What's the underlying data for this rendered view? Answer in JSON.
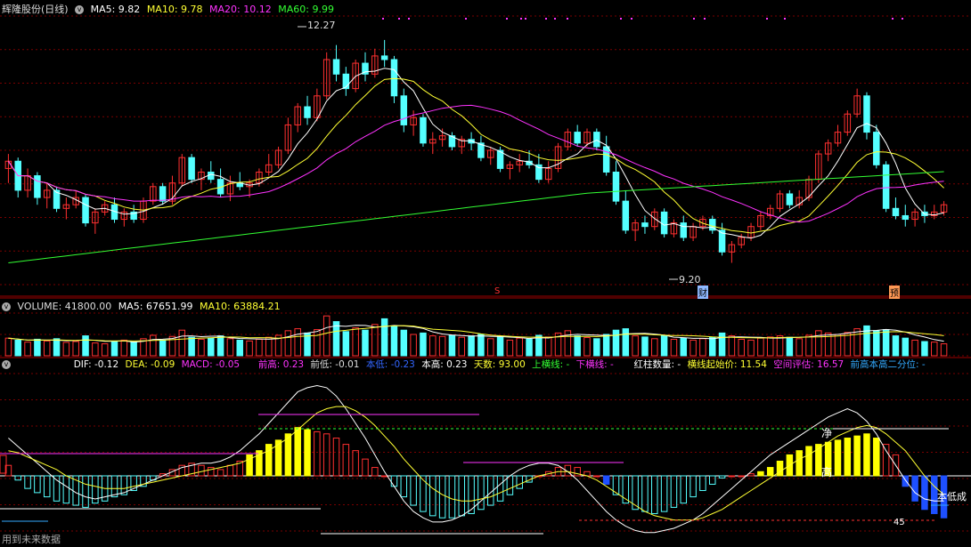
{
  "colors": {
    "up": "#ff3030",
    "down": "#54ffff",
    "ma5": "#ffffff",
    "ma10": "#ffff33",
    "ma20": "#ff33ff",
    "ma60": "#33ff33",
    "grid": "#7a0000",
    "yellow_bar": "#ffff00",
    "blue_bar": "#1e50ff"
  },
  "price_panel": {
    "title": "辉隆股份(日线)",
    "ma5_label": "MA5: 9.82",
    "ma10_label": "MA10: 9.78",
    "ma20_label": "MA20: 10.12",
    "ma60_label": "MA60: 9.99",
    "high_label": "12.27",
    "low_label": "9.20",
    "marker_s": "S",
    "marker_cai": "财",
    "marker_yu": "预"
  },
  "volume_panel": {
    "vol_label": "VOLUME: 41800.00",
    "ma5_label": "MA5: 67651.99",
    "ma10_label": "MA10: 63884.21"
  },
  "macd_panel": {
    "dif_label": "DIF: -0.12",
    "dea_label": "DEA: -0.09",
    "macd_label": "MACD: -0.05",
    "qiangao": "前高: 0.23",
    "qiandi": "前低: -0.01",
    "bendi": "本低: -0.23",
    "bengao": "本高: 0.23",
    "tianshu": "天数: 93.00",
    "shanghx": "上横线: -",
    "xiahx": "下横线: -",
    "hongzhu": "红柱数量: -",
    "hxqsj": "横线起始价: 11.54",
    "kjpg": "空间评估: 16.57",
    "qgbg": "前高本高二分位: -",
    "text_jing": "净",
    "text_gao": "高",
    "text_bendicheng": "本低成",
    "text_45": "45"
  },
  "footer": {
    "text": "用到未来数据"
  },
  "chart_data": {
    "type": "candlestick",
    "price_ylim": [
      8.9,
      12.6
    ],
    "candles": [
      [
        10.5,
        10.7,
        10.3,
        10.6
      ],
      [
        10.6,
        10.65,
        10.1,
        10.2
      ],
      [
        10.2,
        10.5,
        10.1,
        10.4
      ],
      [
        10.4,
        10.45,
        10.0,
        10.1
      ],
      [
        10.1,
        10.3,
        9.95,
        10.2
      ],
      [
        10.2,
        10.25,
        9.9,
        9.95
      ],
      [
        9.95,
        10.1,
        9.8,
        10.0
      ],
      [
        10.0,
        10.2,
        9.95,
        10.1
      ],
      [
        10.1,
        10.15,
        9.7,
        9.75
      ],
      [
        9.75,
        9.95,
        9.6,
        9.9
      ],
      [
        9.9,
        10.05,
        9.85,
        10.0
      ],
      [
        10.0,
        10.1,
        9.75,
        9.8
      ],
      [
        9.8,
        9.95,
        9.7,
        9.9
      ],
      [
        9.9,
        10.0,
        9.75,
        9.8
      ],
      [
        9.8,
        10.1,
        9.75,
        10.05
      ],
      [
        10.05,
        10.3,
        10.0,
        10.25
      ],
      [
        10.25,
        10.3,
        10.0,
        10.05
      ],
      [
        10.05,
        10.4,
        10.0,
        10.3
      ],
      [
        10.3,
        10.7,
        10.25,
        10.65
      ],
      [
        10.65,
        10.7,
        10.3,
        10.35
      ],
      [
        10.35,
        10.5,
        10.2,
        10.45
      ],
      [
        10.45,
        10.6,
        10.3,
        10.35
      ],
      [
        10.35,
        10.5,
        10.1,
        10.15
      ],
      [
        10.15,
        10.4,
        10.05,
        10.3
      ],
      [
        10.3,
        10.45,
        10.2,
        10.25
      ],
      [
        10.25,
        10.35,
        10.1,
        10.3
      ],
      [
        10.3,
        10.5,
        10.25,
        10.45
      ],
      [
        10.45,
        10.7,
        10.4,
        10.55
      ],
      [
        10.55,
        10.8,
        10.5,
        10.75
      ],
      [
        10.75,
        11.2,
        10.7,
        11.1
      ],
      [
        11.1,
        11.4,
        11.0,
        11.35
      ],
      [
        11.35,
        11.5,
        11.1,
        11.2
      ],
      [
        11.2,
        11.6,
        11.15,
        11.5
      ],
      [
        11.5,
        12.1,
        11.45,
        12.0
      ],
      [
        12.0,
        12.2,
        11.7,
        11.8
      ],
      [
        11.8,
        11.9,
        11.5,
        11.6
      ],
      [
        11.6,
        12.0,
        11.55,
        11.95
      ],
      [
        11.95,
        12.1,
        11.7,
        11.8
      ],
      [
        11.8,
        12.15,
        11.75,
        12.05
      ],
      [
        12.05,
        12.27,
        11.9,
        12.0
      ],
      [
        12.0,
        12.05,
        11.4,
        11.5
      ],
      [
        11.5,
        11.6,
        11.0,
        11.1
      ],
      [
        11.1,
        11.3,
        10.95,
        11.2
      ],
      [
        11.2,
        11.25,
        10.8,
        10.85
      ],
      [
        10.85,
        11.0,
        10.7,
        10.9
      ],
      [
        10.9,
        11.05,
        10.8,
        10.95
      ],
      [
        10.95,
        11.0,
        10.75,
        10.8
      ],
      [
        10.8,
        10.95,
        10.7,
        10.9
      ],
      [
        10.9,
        11.0,
        10.75,
        10.85
      ],
      [
        10.85,
        10.95,
        10.6,
        10.65
      ],
      [
        10.65,
        10.8,
        10.55,
        10.75
      ],
      [
        10.75,
        10.8,
        10.45,
        10.5
      ],
      [
        10.5,
        10.6,
        10.35,
        10.55
      ],
      [
        10.55,
        10.7,
        10.45,
        10.6
      ],
      [
        10.6,
        10.75,
        10.5,
        10.55
      ],
      [
        10.55,
        10.7,
        10.3,
        10.35
      ],
      [
        10.35,
        10.6,
        10.3,
        10.5
      ],
      [
        10.5,
        10.85,
        10.45,
        10.8
      ],
      [
        10.8,
        11.05,
        10.75,
        11.0
      ],
      [
        11.0,
        11.1,
        10.8,
        10.85
      ],
      [
        10.85,
        11.05,
        10.8,
        11.0
      ],
      [
        11.0,
        11.05,
        10.75,
        10.8
      ],
      [
        10.8,
        10.95,
        10.4,
        10.45
      ],
      [
        10.45,
        10.6,
        10.0,
        10.05
      ],
      [
        10.05,
        10.2,
        9.6,
        9.65
      ],
      [
        9.65,
        9.8,
        9.5,
        9.75
      ],
      [
        9.75,
        9.85,
        9.6,
        9.7
      ],
      [
        9.7,
        9.95,
        9.65,
        9.9
      ],
      [
        9.9,
        9.95,
        9.55,
        9.6
      ],
      [
        9.6,
        9.8,
        9.55,
        9.75
      ],
      [
        9.75,
        9.85,
        9.5,
        9.55
      ],
      [
        9.55,
        9.75,
        9.5,
        9.7
      ],
      [
        9.7,
        9.85,
        9.65,
        9.8
      ],
      [
        9.8,
        9.85,
        9.6,
        9.65
      ],
      [
        9.65,
        9.75,
        9.3,
        9.35
      ],
      [
        9.35,
        9.5,
        9.2,
        9.45
      ],
      [
        9.45,
        9.6,
        9.4,
        9.55
      ],
      [
        9.55,
        9.75,
        9.5,
        9.7
      ],
      [
        9.7,
        9.9,
        9.65,
        9.85
      ],
      [
        9.85,
        10.0,
        9.8,
        9.95
      ],
      [
        9.95,
        10.2,
        9.9,
        10.15
      ],
      [
        10.15,
        10.2,
        9.95,
        10.0
      ],
      [
        10.0,
        10.2,
        9.95,
        10.1
      ],
      [
        10.1,
        10.4,
        10.05,
        10.35
      ],
      [
        10.35,
        10.75,
        10.3,
        10.7
      ],
      [
        10.7,
        10.9,
        10.6,
        10.85
      ],
      [
        10.85,
        11.1,
        10.8,
        11.0
      ],
      [
        11.0,
        11.3,
        10.95,
        11.25
      ],
      [
        11.25,
        11.6,
        11.2,
        11.5
      ],
      [
        11.5,
        11.55,
        10.9,
        11.0
      ],
      [
        11.0,
        11.1,
        10.5,
        10.55
      ],
      [
        10.55,
        10.6,
        9.9,
        9.95
      ],
      [
        9.95,
        10.1,
        9.8,
        9.85
      ],
      [
        9.85,
        10.0,
        9.7,
        9.8
      ],
      [
        9.8,
        9.95,
        9.7,
        9.9
      ],
      [
        9.9,
        10.0,
        9.75,
        9.85
      ],
      [
        9.85,
        10.0,
        9.8,
        9.9
      ],
      [
        9.9,
        10.05,
        9.85,
        10.0
      ]
    ],
    "volume": [
      62,
      55,
      48,
      58,
      52,
      60,
      47,
      50,
      70,
      45,
      42,
      50,
      55,
      48,
      60,
      72,
      55,
      68,
      90,
      65,
      58,
      62,
      70,
      60,
      55,
      52,
      58,
      65,
      72,
      88,
      95,
      80,
      92,
      140,
      120,
      85,
      98,
      90,
      110,
      130,
      105,
      90,
      75,
      80,
      70,
      68,
      72,
      65,
      70,
      75,
      60,
      68,
      55,
      62,
      58,
      72,
      66,
      80,
      88,
      70,
      64,
      60,
      75,
      90,
      95,
      70,
      66,
      60,
      72,
      58,
      62,
      55,
      60,
      64,
      80,
      70,
      58,
      55,
      62,
      66,
      70,
      65,
      60,
      72,
      88,
      80,
      75,
      82,
      95,
      105,
      88,
      92,
      70,
      62,
      55,
      50,
      48,
      42
    ],
    "macd_hist": [
      0.05,
      -0.02,
      -0.06,
      -0.08,
      -0.1,
      -0.12,
      -0.13,
      -0.14,
      -0.15,
      -0.13,
      -0.12,
      -0.1,
      -0.09,
      -0.07,
      -0.05,
      -0.02,
      0.01,
      0.03,
      0.05,
      0.06,
      0.05,
      0.04,
      0.03,
      0.05,
      0.07,
      0.1,
      0.12,
      0.15,
      0.17,
      0.2,
      0.23,
      0.22,
      0.21,
      0.2,
      0.18,
      0.15,
      0.12,
      0.08,
      0.04,
      0.0,
      -0.05,
      -0.1,
      -0.14,
      -0.17,
      -0.19,
      -0.2,
      -0.2,
      -0.19,
      -0.18,
      -0.16,
      -0.14,
      -0.12,
      -0.09,
      -0.06,
      -0.03,
      0.0,
      0.02,
      0.04,
      0.05,
      0.04,
      0.02,
      0.0,
      -0.04,
      -0.09,
      -0.13,
      -0.16,
      -0.17,
      -0.18,
      -0.17,
      -0.15,
      -0.13,
      -0.1,
      -0.07,
      -0.04,
      -0.01,
      0.0,
      0.0,
      0.01,
      0.02,
      0.04,
      0.07,
      0.1,
      0.12,
      0.14,
      0.15,
      0.16,
      0.17,
      0.18,
      0.19,
      0.2,
      0.18,
      0.15,
      0.1,
      -0.05,
      -0.12,
      -0.16,
      -0.18,
      -0.2
    ],
    "dif": [
      0.18,
      0.14,
      0.1,
      0.06,
      0.02,
      -0.02,
      -0.05,
      -0.08,
      -0.1,
      -0.11,
      -0.1,
      -0.09,
      -0.08,
      -0.06,
      -0.04,
      -0.02,
      0.0,
      0.02,
      0.04,
      0.05,
      0.06,
      0.06,
      0.07,
      0.09,
      0.12,
      0.16,
      0.2,
      0.25,
      0.3,
      0.35,
      0.4,
      0.42,
      0.43,
      0.42,
      0.38,
      0.32,
      0.25,
      0.18,
      0.1,
      0.02,
      -0.05,
      -0.12,
      -0.17,
      -0.2,
      -0.22,
      -0.22,
      -0.21,
      -0.19,
      -0.16,
      -0.12,
      -0.08,
      -0.04,
      0.0,
      0.03,
      0.05,
      0.06,
      0.06,
      0.05,
      0.02,
      -0.02,
      -0.07,
      -0.12,
      -0.17,
      -0.21,
      -0.24,
      -0.26,
      -0.27,
      -0.27,
      -0.26,
      -0.25,
      -0.23,
      -0.21,
      -0.18,
      -0.14,
      -0.1,
      -0.06,
      -0.02,
      0.02,
      0.06,
      0.1,
      0.13,
      0.16,
      0.19,
      0.22,
      0.25,
      0.28,
      0.3,
      0.32,
      0.3,
      0.26,
      0.2,
      0.12,
      0.05,
      -0.02,
      -0.08,
      -0.11,
      -0.12,
      -0.12
    ],
    "dea": [
      0.12,
      0.11,
      0.09,
      0.07,
      0.05,
      0.03,
      0.0,
      -0.02,
      -0.04,
      -0.05,
      -0.06,
      -0.06,
      -0.06,
      -0.05,
      -0.04,
      -0.03,
      -0.02,
      -0.01,
      0.0,
      0.01,
      0.02,
      0.03,
      0.04,
      0.05,
      0.06,
      0.08,
      0.1,
      0.12,
      0.15,
      0.18,
      0.22,
      0.26,
      0.3,
      0.32,
      0.33,
      0.33,
      0.31,
      0.28,
      0.24,
      0.19,
      0.14,
      0.08,
      0.03,
      -0.02,
      -0.06,
      -0.09,
      -0.11,
      -0.12,
      -0.12,
      -0.11,
      -0.1,
      -0.08,
      -0.06,
      -0.04,
      -0.02,
      0.0,
      0.01,
      0.02,
      0.02,
      0.01,
      0.0,
      -0.02,
      -0.05,
      -0.08,
      -0.11,
      -0.14,
      -0.17,
      -0.19,
      -0.2,
      -0.21,
      -0.21,
      -0.21,
      -0.2,
      -0.18,
      -0.16,
      -0.13,
      -0.1,
      -0.07,
      -0.04,
      -0.01,
      0.02,
      0.05,
      0.08,
      0.1,
      0.13,
      0.16,
      0.19,
      0.21,
      0.23,
      0.24,
      0.23,
      0.2,
      0.16,
      0.12,
      0.06,
      0.0,
      -0.05,
      -0.09
    ]
  }
}
